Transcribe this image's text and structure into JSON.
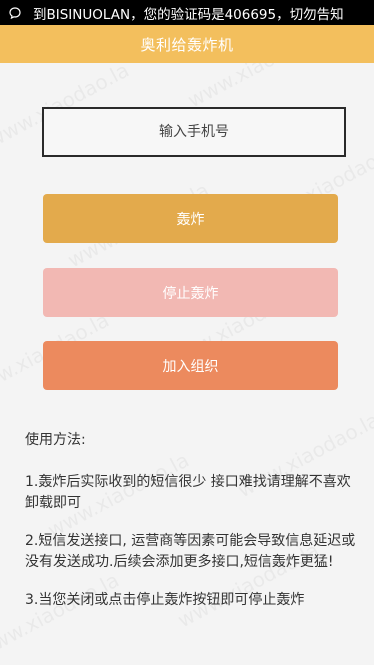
{
  "statusbar": {
    "notification_text": "到BISINUOLAN，您的验证码是406695，切勿告知"
  },
  "appbar": {
    "title": "奥利给轰炸机"
  },
  "phone_input": {
    "placeholder": "输入手机号",
    "value": ""
  },
  "buttons": {
    "bomb": "轰炸",
    "stop": "停止轰炸",
    "join": "加入组织"
  },
  "instructions": {
    "heading": "使用方法:",
    "steps": [
      "1.轰炸后实际收到的短信很少 接口难找请理解不喜欢卸载即可",
      "2.短信发送接口, 运营商等因素可能会导致信息延迟或没有发送成功.后续会添加更多接口,短信轰炸更猛!",
      "3.当您关闭或点击停止轰炸按钮即可停止轰炸"
    ]
  },
  "watermark": "www.xiaodao.la",
  "colors": {
    "appbar": "#f3bf5d",
    "bomb_button": "#e3aa4c",
    "stop_button": "#f2b8b3",
    "join_button": "#ec8a5e"
  }
}
